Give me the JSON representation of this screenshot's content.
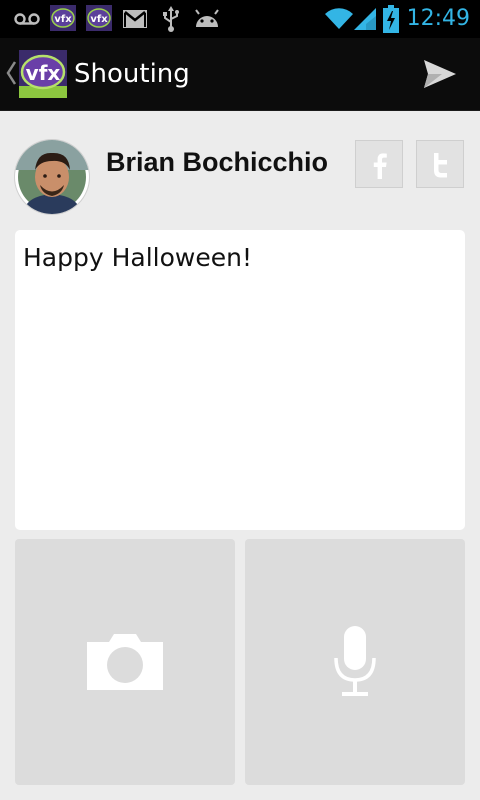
{
  "status_bar": {
    "time": "12:49",
    "icons": [
      "voicemail-icon",
      "vfx-app-icon",
      "vfx-app-icon",
      "gmail-icon",
      "usb-icon",
      "android-debug-icon",
      "wifi-icon",
      "cell-signal-icon",
      "battery-charging-icon"
    ],
    "accent_color": "#33b5e5"
  },
  "action_bar": {
    "title": "Shouting",
    "logo_icon": "vfx-logo-icon",
    "send_icon": "send-icon"
  },
  "user": {
    "name": "Brian Bochicchio",
    "avatar_icon": "avatar-photo"
  },
  "share": {
    "facebook_icon": "facebook-icon",
    "twitter_icon": "twitter-icon"
  },
  "message": {
    "text": "Happy Halloween!"
  },
  "attachments": {
    "camera_icon": "camera-icon",
    "microphone_icon": "microphone-icon"
  }
}
